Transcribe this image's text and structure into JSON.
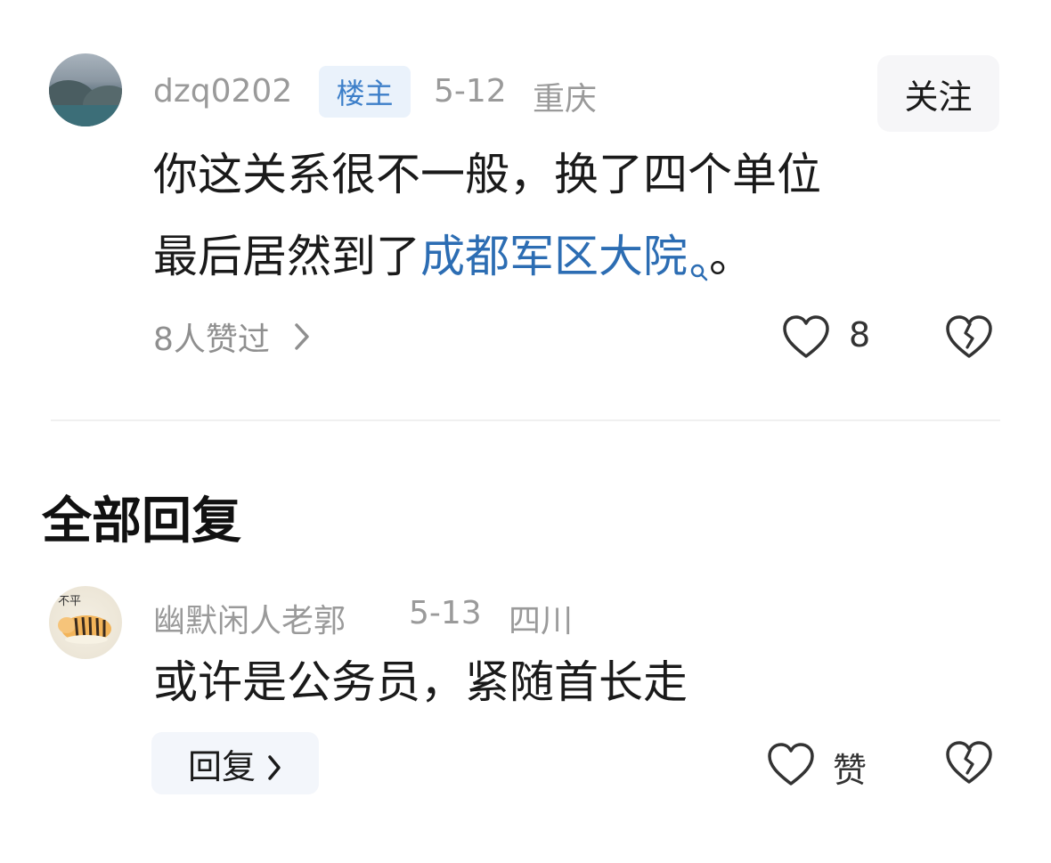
{
  "op_comment": {
    "username": "dzq0202",
    "badge": "楼主",
    "date": "5-12",
    "location": "重庆",
    "follow_label": "关注",
    "text_line1": "你这关系很不一般，换了四个单位",
    "text_line2_prefix": "最后居然到了",
    "link_text": "成都军区大院",
    "text_line2_suffix": "。",
    "likers_text": "8人赞过",
    "like_count": "8"
  },
  "all_replies": {
    "title": "全部回复"
  },
  "reply": {
    "username": "幽默闲人老郭",
    "date": "5-13",
    "location": "四川",
    "text": "或许是公务员，紧随首长走",
    "reply_button_label": "回复",
    "like_label": "赞",
    "avatar_text": "不平"
  },
  "icons": {
    "heart": "heart-icon",
    "dislike": "broken-heart-icon",
    "chevron": "chevron-right-icon",
    "search": "search-icon"
  },
  "colors": {
    "link": "#2c6db3",
    "badge_bg": "#eaf2fb",
    "badge_text": "#3d7fc9",
    "meta_text": "#9a9a9a"
  }
}
